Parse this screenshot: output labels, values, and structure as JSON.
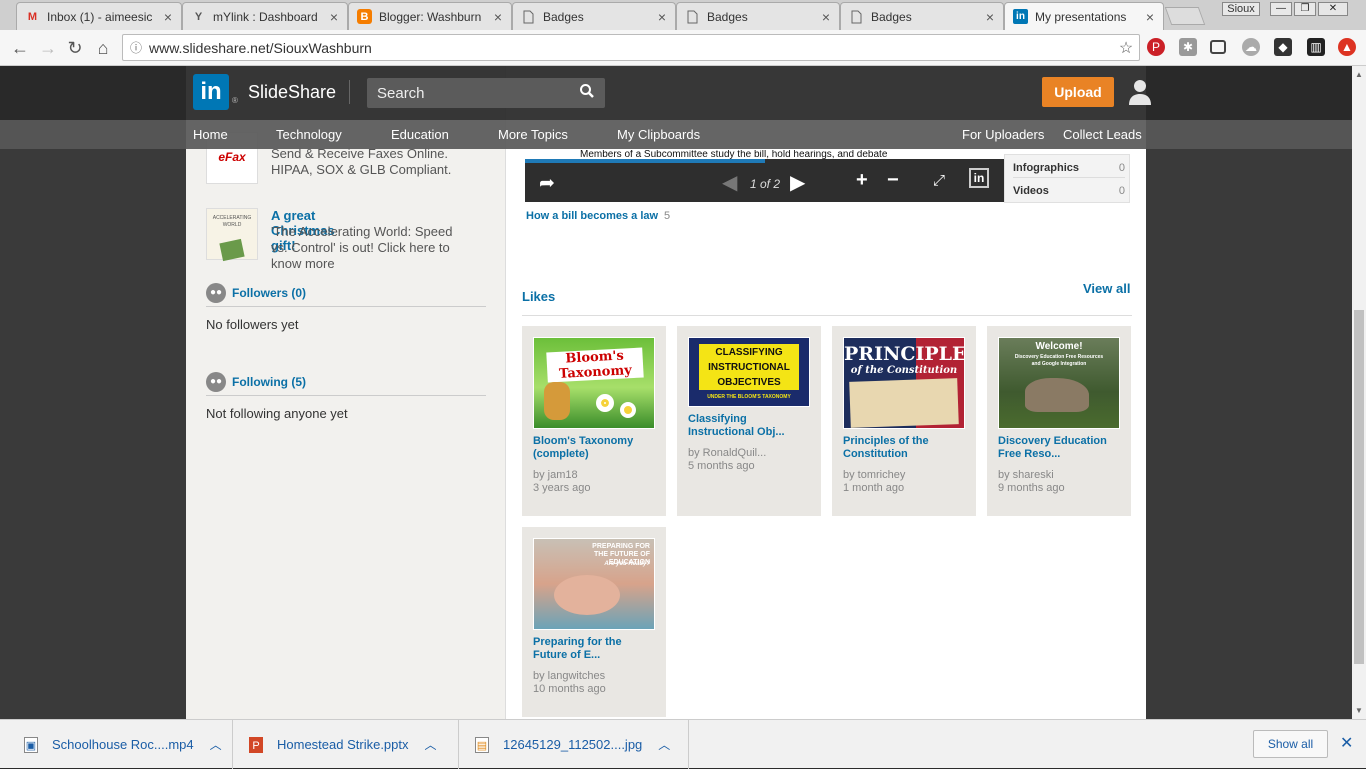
{
  "browser": {
    "tabs": [
      {
        "label": "Inbox (1) - aimeesic",
        "icon": "gmail-icon",
        "color": "#d93025",
        "glyph": "M"
      },
      {
        "label": "mYlink : Dashboard",
        "icon": "mylink-icon",
        "color": "#555555",
        "glyph": "Y"
      },
      {
        "label": "Blogger: Washburn",
        "icon": "blogger-icon",
        "color": "#f57d00",
        "glyph": "B"
      },
      {
        "label": "Badges",
        "icon": "page-icon",
        "color": "#666666",
        "glyph": ""
      },
      {
        "label": "Badges",
        "icon": "page-icon",
        "color": "#666666",
        "glyph": ""
      },
      {
        "label": "Badges",
        "icon": "page-icon",
        "color": "#666666",
        "glyph": ""
      },
      {
        "label": "My presentations",
        "icon": "linkedin-icon",
        "color": "#0077b5",
        "glyph": "in"
      }
    ],
    "profile": "Sioux",
    "url": "www.slideshare.net/SiouxWashburn"
  },
  "header": {
    "logo": "in",
    "brand": "SlideShare",
    "search_placeholder": "Search",
    "upload_label": "Upload"
  },
  "nav": {
    "items": [
      "Home",
      "Technology",
      "Education",
      "More Topics",
      "My Clipboards"
    ],
    "right": [
      "For Uploaders",
      "Collect Leads"
    ]
  },
  "sidebar": {
    "ad1": {
      "logo": "eFax",
      "text": "Send & Receive Faxes Online. HIPAA, SOX & GLB Compliant."
    },
    "ad2": {
      "book": "ACCELERATING WORLD",
      "title": "A great Christmas gift!",
      "text": "'The Accelerating World: Speed vs. Control' is out! Click here to know more"
    },
    "followers": {
      "label": "Followers (0)",
      "text": "No followers yet"
    },
    "following": {
      "label": "Following (5)",
      "text": "Not following anyone yet"
    }
  },
  "player": {
    "caption": "Members of a Subcommittee study the bill, hold hearings, and debate",
    "page": "1 of 2",
    "progress": 0.5
  },
  "doc_types": [
    {
      "label": "Infographics",
      "count": "0"
    },
    {
      "label": "Videos",
      "count": "0"
    }
  ],
  "presentation": {
    "title": "How a bill becomes a law",
    "count": "5"
  },
  "likes": {
    "heading": "Likes",
    "view_all": "View all",
    "items": [
      {
        "title": "Bloom's Taxonomy (complete)",
        "by": "by jam18",
        "ago": "3 years ago",
        "thumb": "Bloom's Taxonomy"
      },
      {
        "title": "Classifying Instructional Obj...",
        "by": "by RonaldQuil...",
        "ago": "5 months ago",
        "thumb": "CLASSIFYING INSTRUCTIONAL OBJECTIVES",
        "thumb_sub": "UNDER THE BLOOM'S TAXONOMY"
      },
      {
        "title": "Principles of the Constitution",
        "by": "by tomrichey",
        "ago": "1 month ago",
        "thumb": "PRINCIPLES",
        "thumb_sub": "of the Constitution"
      },
      {
        "title": "Discovery Education Free Reso...",
        "by": "by shareski",
        "ago": "9 months ago",
        "thumb": "Welcome!",
        "thumb_sub": "Discovery Education Free Resources and Google Integration"
      },
      {
        "title": "Preparing for the Future of E...",
        "by": "by langwitches",
        "ago": "10 months ago",
        "thumb": "PREPARING FOR THE FUTURE OF EDUCATION",
        "thumb_sub": "Are you Ready?"
      }
    ]
  },
  "downloads": {
    "items": [
      {
        "name": "Schoolhouse Roc....mp4",
        "icon": "video-file-icon"
      },
      {
        "name": "Homestead Strike.pptx",
        "icon": "pptx-file-icon"
      },
      {
        "name": "12645129_112502....jpg",
        "icon": "image-file-icon"
      }
    ],
    "show_all": "Show all"
  }
}
